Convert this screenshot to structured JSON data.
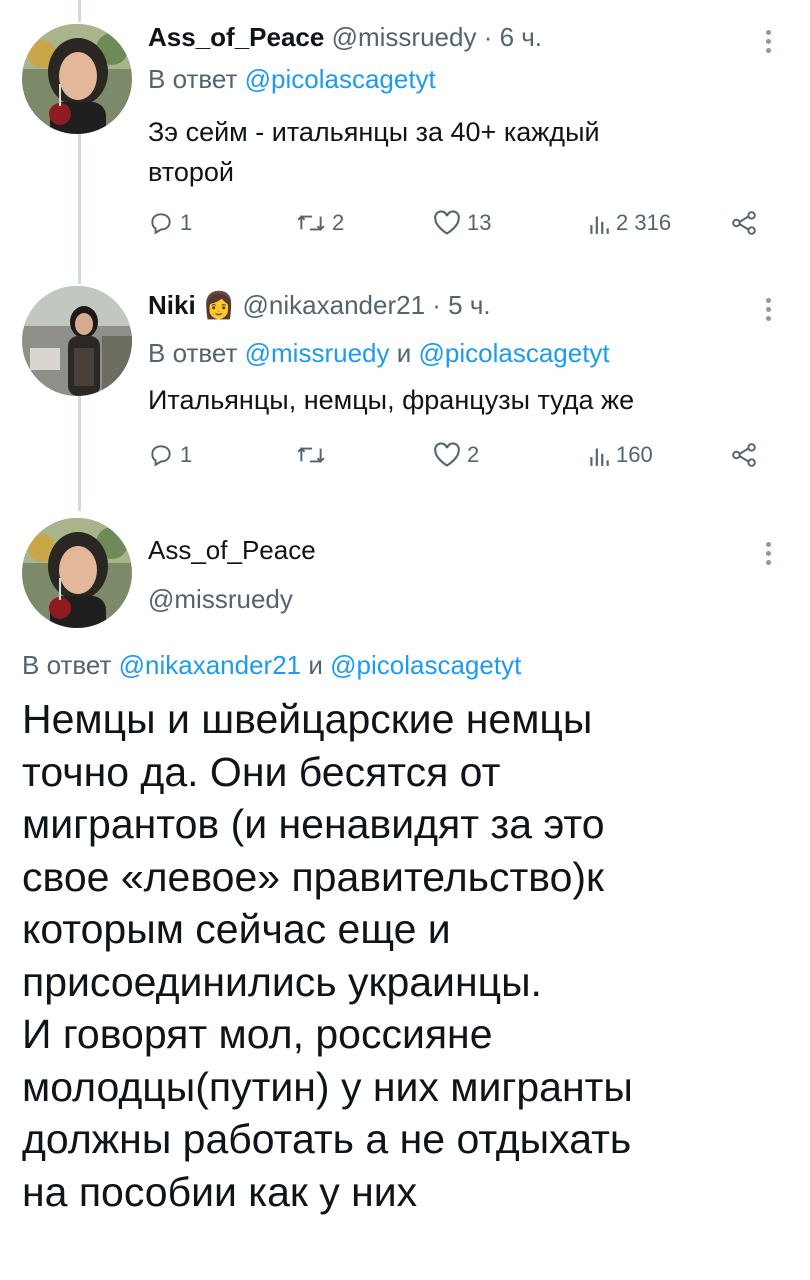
{
  "tweet1": {
    "display_name": "Ass_of_Peace",
    "handle": "@missruedy",
    "time": "· 6 ч.",
    "reply_prefix": "В ответ",
    "reply_to": "@picolascagetyt",
    "text_lines": [
      "Зэ сейм - итальянцы за 40+ каждый",
      "второй"
    ],
    "stats": {
      "replies": "1",
      "retweets": "2",
      "likes": "13",
      "views": "2 316"
    }
  },
  "tweet2": {
    "display_name": "Niki",
    "name_emoji": "👩",
    "handle": "@nikaxander21",
    "time": "· 5 ч.",
    "reply_prefix": "В ответ",
    "reply_to_1": "@missruedy",
    "reply_and": "и",
    "reply_to_2": "@picolascagetyt",
    "text": "Итальянцы, немцы, французы туда же",
    "stats": {
      "replies": "1",
      "retweets": "",
      "likes": "2",
      "views": "160"
    }
  },
  "tweet3": {
    "display_name": "Ass_of_Peace",
    "handle": "@missruedy",
    "reply_prefix": "В ответ",
    "reply_to_1": "@nikaxander21",
    "reply_and": "и",
    "reply_to_2": "@picolascagetyt",
    "text_lines": [
      "Немцы и швейцарские немцы",
      "точно да. Они бесятся от",
      "мигрантов  (и ненавидят за это",
      "свое «левое» правительство)к",
      "которым сейчас еще и",
      "присоединились украинцы.",
      "И говорят мол, россияне",
      "молодцы(путин) у них мигранты",
      "должны работать а не отдыхать",
      "на пособии как у них"
    ]
  },
  "colors": {
    "link": "#1d9bf0",
    "muted": "#536471",
    "text": "#0f1419",
    "thread_line": "#cfd9de"
  },
  "icons": [
    "reply-icon",
    "retweet-icon",
    "like-icon",
    "views-icon",
    "share-icon",
    "more-icon"
  ]
}
